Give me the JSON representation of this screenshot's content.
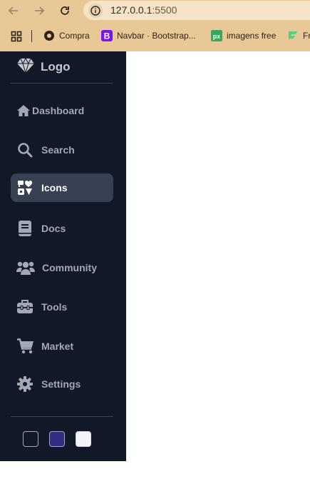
{
  "browser": {
    "url_host": "127.0.0.1",
    "url_port": ":5500",
    "nav_icons": [
      "back-arrow-icon",
      "forward-arrow-icon",
      "reload-icon"
    ],
    "bookmarks": [
      {
        "label": "Compra",
        "icon": "chrome-icon"
      },
      {
        "label": "Navbar · Bootstrap...",
        "icon": "bootstrap-icon"
      },
      {
        "label": "imagens free",
        "icon": "px-icon"
      },
      {
        "label": "Fr",
        "icon": "flaticon-icon"
      }
    ]
  },
  "sidebar": {
    "logo_label": "Logo",
    "logo_icon": "gem-icon",
    "items": [
      {
        "label": "Dashboard",
        "icon": "home-icon",
        "active": false
      },
      {
        "label": "Search",
        "icon": "search-icon",
        "active": false
      },
      {
        "label": "Icons",
        "icon": "icons-icon",
        "active": true
      },
      {
        "label": "Docs",
        "icon": "book-icon",
        "active": false
      },
      {
        "label": "Community",
        "icon": "users-icon",
        "active": false
      },
      {
        "label": "Tools",
        "icon": "toolbox-icon",
        "active": false
      },
      {
        "label": "Market",
        "icon": "cart-icon",
        "active": false
      },
      {
        "label": "Settings",
        "icon": "gear-icon",
        "active": false
      }
    ],
    "theme_swatches": [
      {
        "name": "dark",
        "color": "#111827"
      },
      {
        "name": "indigo",
        "color": "#312e81"
      },
      {
        "name": "light",
        "color": "#f3f4f6"
      }
    ]
  },
  "colors": {
    "sidebar_bg": "#111827",
    "active_bg": "#374151",
    "browser_frame": "#e8c896"
  }
}
